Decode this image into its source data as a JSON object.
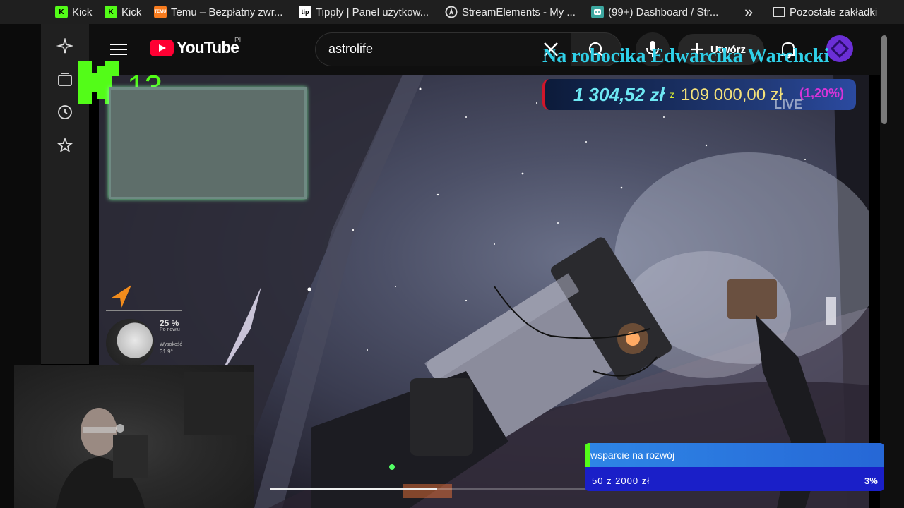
{
  "bookmarks": [
    {
      "label": "Kick",
      "icon": "kick-icon"
    },
    {
      "label": "Kick",
      "icon": "kick-icon"
    },
    {
      "label": "Temu – Bezpłatny zwr...",
      "icon": "temu-icon"
    },
    {
      "label": "Tipply | Panel użytkow...",
      "icon": "tipply-icon"
    },
    {
      "label": "StreamElements - My ...",
      "icon": "streamelements-icon"
    },
    {
      "label": "(99+) Dashboard / Str...",
      "icon": "dashboard-icon"
    }
  ],
  "bookmarks_more": "»",
  "bookmarks_folder": "Pozostałe zakładki",
  "youtube": {
    "wordmark": "YouTube",
    "region": "PL",
    "search_value": "astrolife",
    "create_label": "Utwórz"
  },
  "overlay": {
    "kick_count": "13",
    "ticker": "Na robocika Edwarcika Warchcki",
    "goal_current": "1 304,52 zł",
    "goal_separator": "z",
    "goal_target": "109 000,00 zł",
    "goal_percent": "(1,20%)",
    "goal_fraction": 0.012,
    "live_badge": "LIVE",
    "moon_phase_pct": "25 %",
    "moon_phase_sub": "Po nowiu",
    "moon_alt_label": "Wysokość",
    "moon_alt": "31.9°"
  },
  "player": {
    "progress_fraction": 0.28
  },
  "support_widget": {
    "title": "wsparcie na rozwój",
    "amount": "50 z 2000 zł",
    "percent": "3%"
  },
  "colors": {
    "kick_green": "#53fc18",
    "youtube_red": "#ff0033",
    "ticker_cyan": "#2fd0e8"
  }
}
